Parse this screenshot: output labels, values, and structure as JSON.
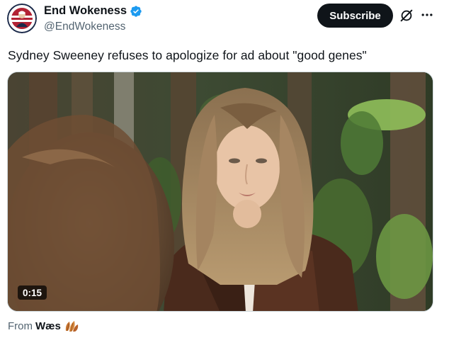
{
  "account": {
    "display_name": "End Wokeness",
    "handle": "@EndWokeness",
    "verified": true,
    "avatar_icon": "end-wokeness-logo",
    "avatar_text": "END WOKENESS"
  },
  "header": {
    "subscribe_label": "Subscribe",
    "grok_icon": "grok-icon",
    "more_icon": "more-dots-icon"
  },
  "tweet": {
    "text": "Sydney Sweeney refuses to apologize for ad about \"good genes\""
  },
  "media": {
    "type": "video",
    "duration": "0:15"
  },
  "attribution": {
    "prefix": "From",
    "source_name": "Wæs",
    "source_icon": "leaves-icon"
  },
  "colors": {
    "brand_black": "#0f1419",
    "secondary_text": "#536471",
    "verified_blue": "#1d9bf0"
  }
}
